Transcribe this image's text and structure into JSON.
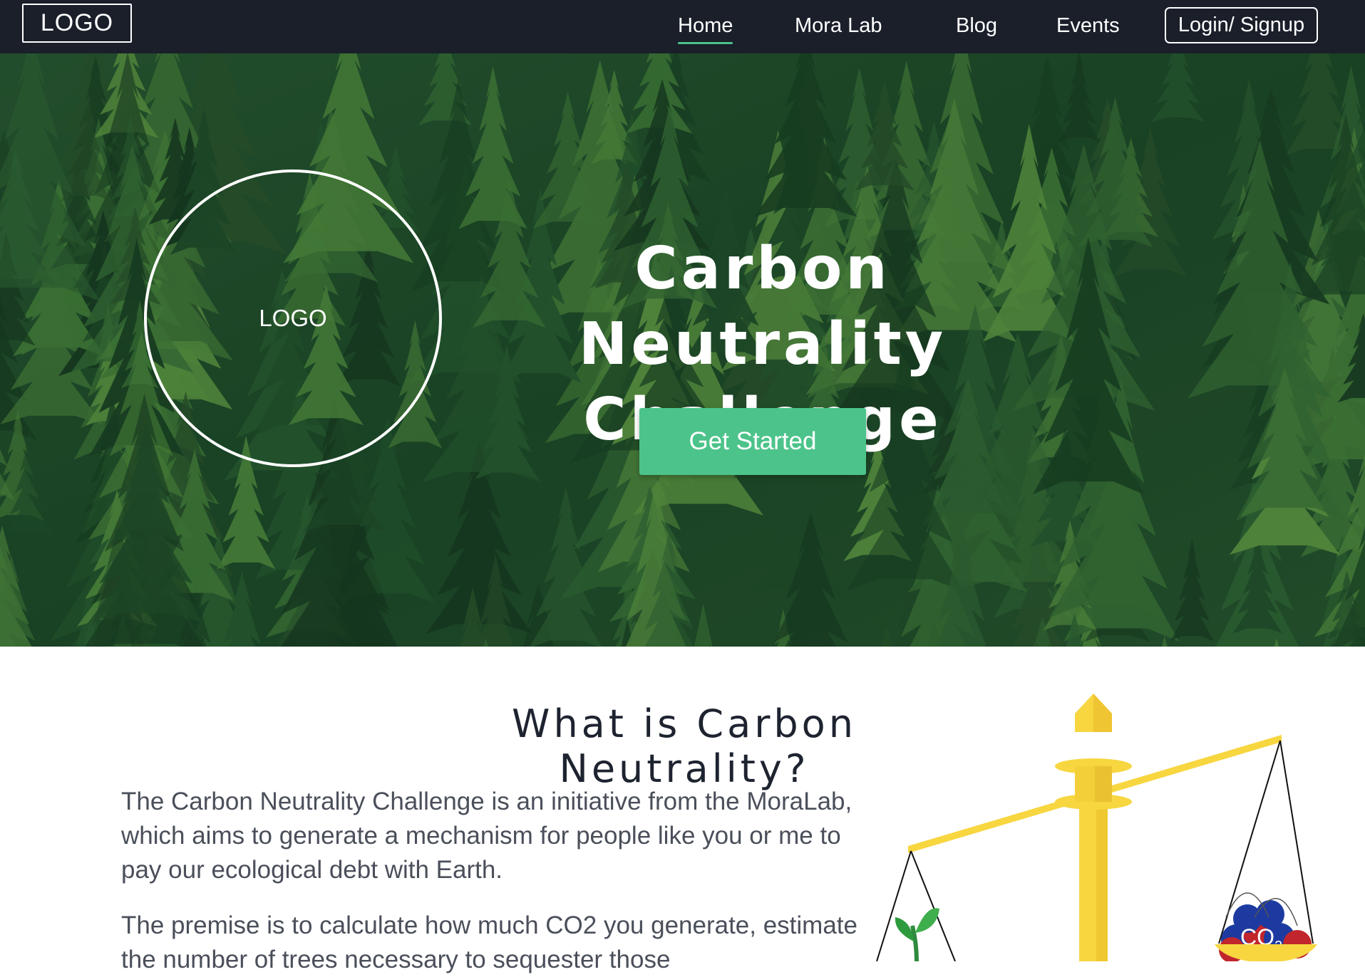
{
  "nav": {
    "logo": "LOGO",
    "links": [
      {
        "label": "Home",
        "active": true
      },
      {
        "label": "Mora Lab",
        "active": false
      },
      {
        "label": "Blog",
        "active": false
      },
      {
        "label": "Events",
        "active": false
      }
    ],
    "login": "Login/ Signup"
  },
  "hero": {
    "logo": "LOGO",
    "title_line1": "Carbon Neutrality",
    "title_line2": "Challenge",
    "cta": "Get Started"
  },
  "content": {
    "heading": "What is Carbon Neutrality?",
    "paragraph1": "The Carbon Neutrality Challenge is an initiative from the MoraLab, which aims to generate a mechanism for people like you or me to pay our ecological debt with Earth.",
    "paragraph2": "The premise is to calculate how much CO2 you generate, estimate the number of trees necessary to sequester those"
  },
  "illustration": {
    "co2_label": "CO2",
    "co2_main": "CO",
    "co2_sub": "2"
  },
  "colors": {
    "nav_bg": "#1a1f2a",
    "accent": "#4cc38a",
    "forest": "#1e4a2a",
    "scale_yellow": "#f7d640"
  }
}
